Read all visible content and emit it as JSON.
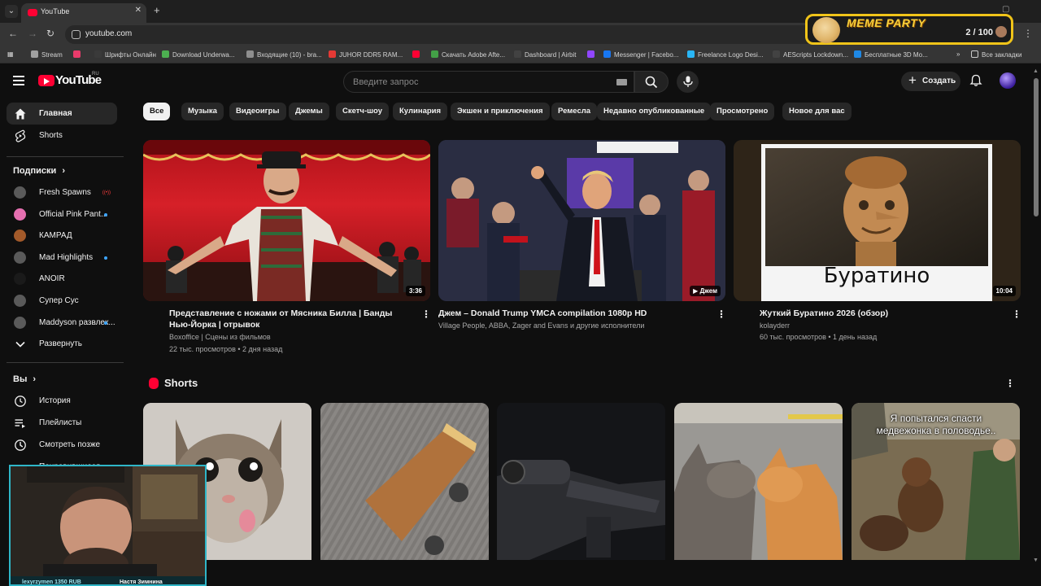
{
  "browser": {
    "tab_title": "YouTube",
    "url": "youtube.com",
    "bookmarks": [
      {
        "label": "Stream",
        "color": "#a0a0a0"
      },
      {
        "label": "",
        "color": "#e93b6b"
      },
      {
        "label": "Шрифты Онлайн",
        "color": "#3a3a3a"
      },
      {
        "label": "Download Underwa...",
        "color": "#4caf50"
      },
      {
        "label": "Входящие (10) - bra...",
        "color": "#8e8e8e"
      },
      {
        "label": "JUHOR DDR5 RAM...",
        "color": "#e53935"
      },
      {
        "label": "",
        "color": "#ff0033"
      },
      {
        "label": "Скачать Adobe Afte...",
        "color": "#43a047"
      },
      {
        "label": "Dashboard | Airbit",
        "color": "#424242"
      },
      {
        "label": "",
        "color": "#9146ff"
      },
      {
        "label": "Messenger | Facebo...",
        "color": "#1877f2"
      },
      {
        "label": "Freelance Logo Desi...",
        "color": "#29b6f6"
      },
      {
        "label": "AEScripts Lockdown...",
        "color": "#424242"
      },
      {
        "label": "Бесплатные 3D Мо...",
        "color": "#1e88e5"
      }
    ],
    "all_bookmarks": "Все закладки"
  },
  "overlay": {
    "meme_title": "MEME PARTY",
    "meme_count": "2 / 100",
    "cam_user": "lexyrzymen 1350 RUB",
    "cam_msg": "Настя Зимнина"
  },
  "header": {
    "logo_word": "YouTube",
    "logo_region": "RU",
    "search_placeholder": "Введите запрос",
    "create_label": "Создать"
  },
  "sidebar": {
    "main": [
      {
        "label": "Главная",
        "icon": "home-icon"
      },
      {
        "label": "Shorts",
        "icon": "shorts-icon"
      }
    ],
    "subscriptions_heading": "Подписки",
    "subscriptions": [
      {
        "label": "Fresh Spawns",
        "badge": "live"
      },
      {
        "label": "Official Pink Pant...",
        "badge": "dot"
      },
      {
        "label": "КАМРАД",
        "badge": ""
      },
      {
        "label": "Mad Highlights",
        "badge": "dot"
      },
      {
        "label": "ANOIR",
        "badge": ""
      },
      {
        "label": "Супер Сус",
        "badge": ""
      },
      {
        "label": "Maddyson развлек...",
        "badge": "dot"
      }
    ],
    "expand_label": "Развернуть",
    "you_heading": "Вы",
    "you_items": [
      {
        "label": "История",
        "icon": "history-icon"
      },
      {
        "label": "Плейлисты",
        "icon": "playlists-icon"
      },
      {
        "label": "Смотреть позже",
        "icon": "watch-later-icon"
      },
      {
        "label": "Понравившиеся",
        "icon": "liked-icon"
      }
    ]
  },
  "chips": [
    "Все",
    "Музыка",
    "Видеоигры",
    "Джемы",
    "Скетч-шоу",
    "Кулинария",
    "Экшен и приключения",
    "Ремесла",
    "Недавно опубликованные",
    "Просмотрено",
    "Новое для вас"
  ],
  "videos": [
    {
      "title": "Представление с ножами от Мясника Билла | Банды Нью-Йорка | отрывок",
      "channel": "Boxoffice | Сцены из фильмов",
      "stats": "22 тыс. просмотров • 2 дня назад",
      "duration": "3:36"
    },
    {
      "title": "Джем – Donald Trump YMCA compilation 1080p HD",
      "channel": "Village People, ABBA, Zager and Evans и другие исполнители",
      "stats": "",
      "duration": "Джем"
    },
    {
      "title": "Жуткий Буратино 2026 (обзор)",
      "channel": "kolayderr",
      "stats": "60 тыс. просмотров • 1 день назад",
      "duration": "10:04",
      "thumb_text": "Буратино"
    }
  ],
  "shorts": {
    "heading": "Shorts",
    "items": [
      {
        "caption": ""
      },
      {
        "caption": ""
      },
      {
        "caption": ""
      },
      {
        "caption": ""
      },
      {
        "caption": "Я попытался спасти медвежонка в половодье.."
      }
    ]
  }
}
